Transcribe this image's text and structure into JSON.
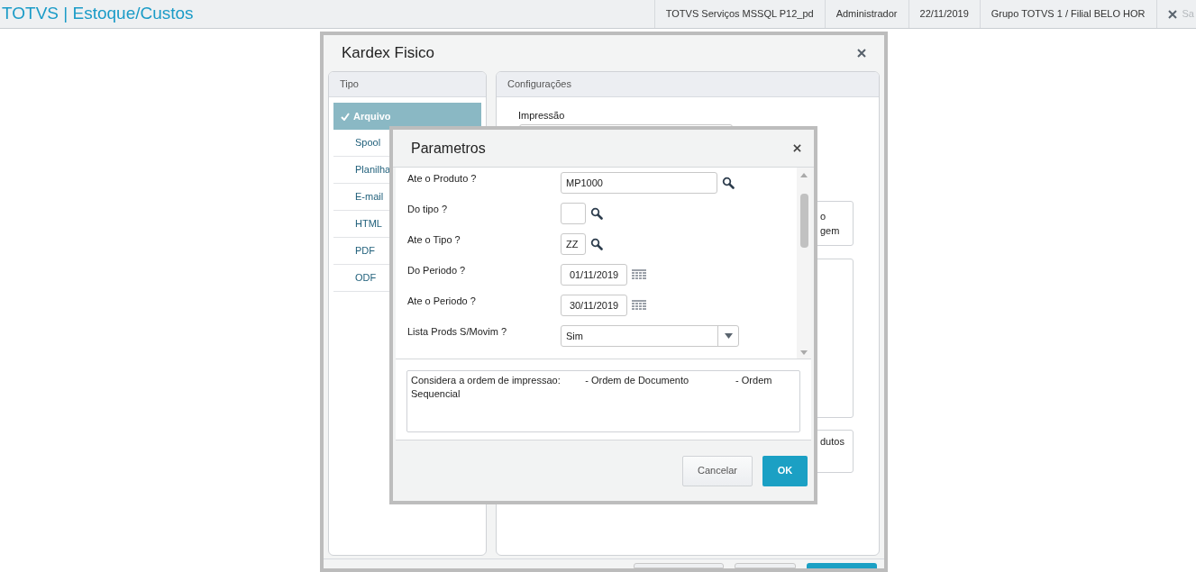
{
  "app_bar": {
    "title": "TOTVS | Estoque/Custos",
    "items": [
      "TOTVS Serviços MSSQL P12_pd",
      "Administrador",
      "22/11/2019",
      "Grupo TOTVS 1 / Filial BELO HOR"
    ],
    "exit_label": "Sa"
  },
  "kardex_dialog": {
    "title": "Kardex Fisico",
    "type_panel": {
      "header": "Tipo",
      "items": [
        {
          "label": "Arquivo",
          "selected": true
        },
        {
          "label": "Spool",
          "selected": false
        },
        {
          "label": "Planilha",
          "selected": false
        },
        {
          "label": "E-mail",
          "selected": false
        },
        {
          "label": "HTML",
          "selected": false
        },
        {
          "label": "PDF",
          "selected": false
        },
        {
          "label": "ODF",
          "selected": false
        }
      ]
    },
    "config_panel": {
      "header": "Configurações",
      "print_label": "Impressão",
      "option_text_lines": [
        "o",
        "gem"
      ],
      "products_text": "dutos"
    }
  },
  "parameters_dialog": {
    "title": "Parametros",
    "fields": [
      {
        "label": "Ate o Produto ?",
        "kind": "wide_lookup",
        "value": "MP1000"
      },
      {
        "label": "Do tipo ?",
        "kind": "lookup"
      },
      {
        "label": "Ate o Tipo ?",
        "kind": "lookup",
        "value": "ZZ"
      },
      {
        "label": "Do Periodo ?",
        "kind": "date",
        "value": "01/11/2019"
      },
      {
        "label": "Ate o Periodo ?",
        "kind": "date",
        "value": "30/11/2019"
      },
      {
        "label": "Lista Prods S/Movim ?",
        "kind": "select",
        "value": "Sim"
      }
    ],
    "description": "Considera a ordem de impressao:         - Ordem de Documento                 - Ordem Sequencial",
    "buttons": [
      {
        "label": "Cancelar",
        "kind": "secondary"
      },
      {
        "label": "OK",
        "kind": "primary"
      }
    ]
  }
}
